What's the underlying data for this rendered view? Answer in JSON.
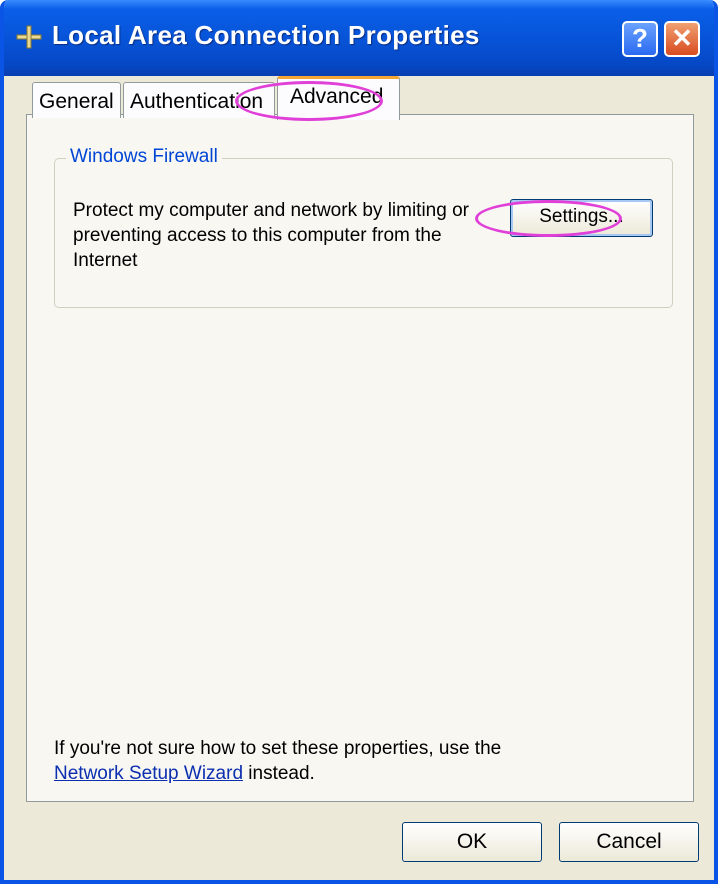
{
  "window": {
    "title": "Local Area Connection Properties",
    "title_icon": "network-connection-icon",
    "help_label": "?",
    "close_label": "✕"
  },
  "tabs": [
    {
      "label": "General",
      "selected": false
    },
    {
      "label": "Authentication",
      "selected": false
    },
    {
      "label": "Advanced",
      "selected": true
    }
  ],
  "firewall_group": {
    "legend": "Windows Firewall",
    "description": "Protect my computer and network by limiting or preventing access to this computer from the Internet",
    "settings_label": "Settings..."
  },
  "footer": {
    "note_prefix": "If you're not sure how to set these properties, use the ",
    "link_text": "Network Setup Wizard",
    "note_suffix": " instead."
  },
  "buttons": {
    "ok_label": "OK",
    "cancel_label": "Cancel"
  },
  "colors": {
    "titlebar": "#0754d8",
    "window_bg": "#ece9d8",
    "legend_text": "#0046d5",
    "active_tab_accent": "#f3a536",
    "annotation": "#e040d8"
  }
}
